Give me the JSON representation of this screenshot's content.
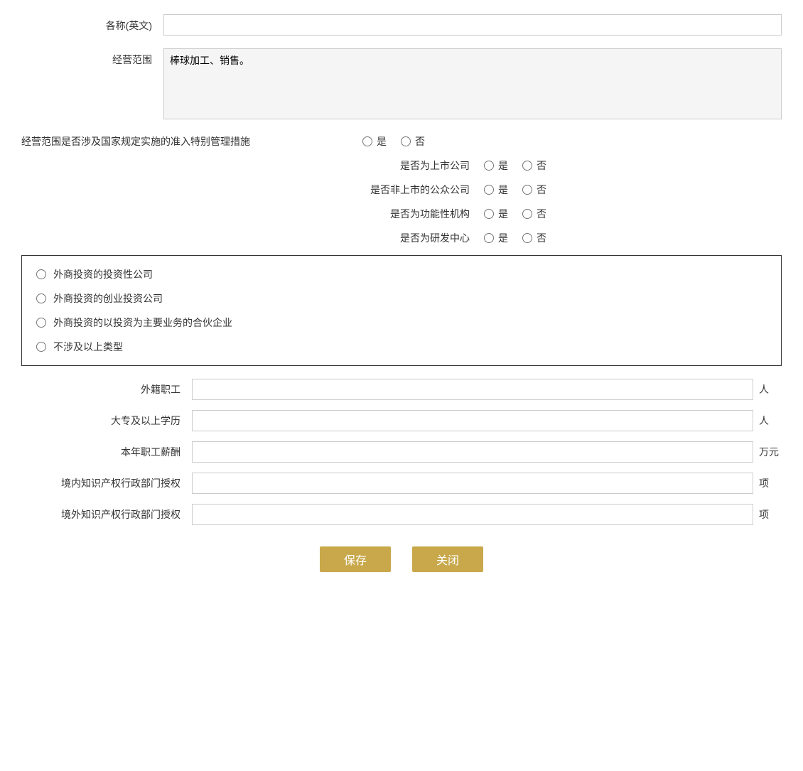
{
  "fields": {
    "english_name_label": "各称(英文)",
    "business_scope_label": "经营范围",
    "business_scope_value": "棒球加工、销售。",
    "business_scope_placeholder": ""
  },
  "radio_rows": [
    {
      "id": "special_mgmt",
      "label": "经营范围是否涉及国家规定实施的准入特别管理措施",
      "options": [
        "是",
        "否"
      ]
    },
    {
      "id": "listed_company",
      "label": "是否为上市公司",
      "options": [
        "是",
        "否"
      ]
    },
    {
      "id": "public_company",
      "label": "是否非上市的公众公司",
      "options": [
        "是",
        "否"
      ]
    },
    {
      "id": "functional_org",
      "label": "是否为功能性机构",
      "options": [
        "是",
        "否"
      ]
    },
    {
      "id": "rd_center",
      "label": "是否为研发中心",
      "options": [
        "是",
        "否"
      ]
    }
  ],
  "checkbox_group": {
    "options": [
      "外商投资的投资性公司",
      "外商投资的创业投资公司",
      "外商投资的以投资为主要业务的合伙企业",
      "不涉及以上类型"
    ]
  },
  "input_fields": [
    {
      "id": "foreign_employees",
      "label": "外籍职工",
      "unit": "人"
    },
    {
      "id": "college_above",
      "label": "大专及以上学历",
      "unit": "人"
    },
    {
      "id": "annual_salary",
      "label": "本年职工薪酬",
      "unit": "万元"
    },
    {
      "id": "domestic_ip",
      "label": "境内知识产权行政部门授权",
      "unit": "项"
    },
    {
      "id": "foreign_ip",
      "label": "境外知识产权行政部门授权",
      "unit": "项"
    }
  ],
  "buttons": {
    "save": "保存",
    "close": "关闭"
  }
}
